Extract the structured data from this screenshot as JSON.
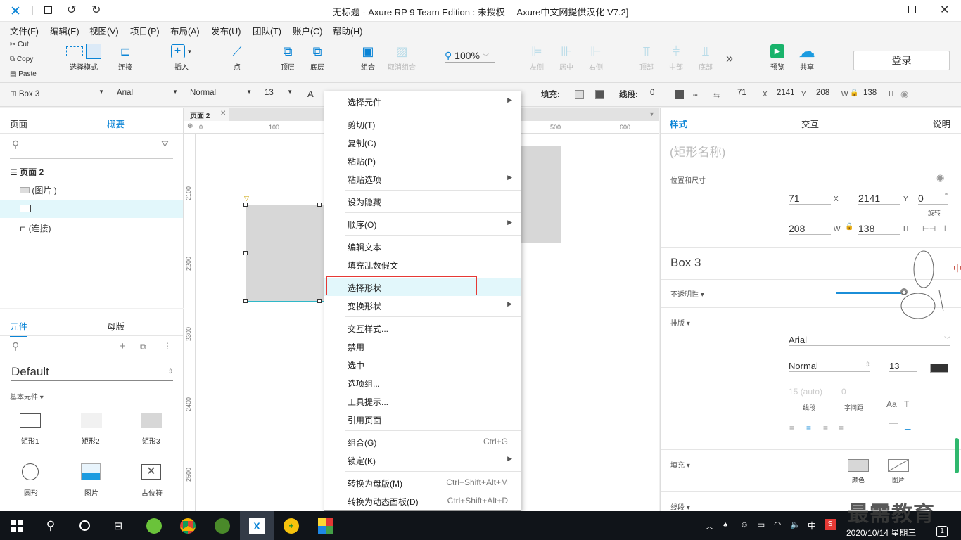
{
  "window": {
    "title": "无标题 - Axure RP 9 Team Edition : 未授权　 Axure中文网提供汉化 V7.2]"
  },
  "menu": [
    "文件(F)",
    "编辑(E)",
    "视图(V)",
    "项目(P)",
    "布局(A)",
    "发布(U)",
    "团队(T)",
    "账户(C)",
    "帮助(H)"
  ],
  "clipboard": {
    "cut": "Cut",
    "copy": "Copy",
    "paste": "Paste"
  },
  "toolbar": {
    "select_mode": "选择模式",
    "connect": "连接",
    "insert": "插入",
    "point": "点",
    "top": "顶层",
    "bottom": "底层",
    "group": "组合",
    "ungroup": "取消组合",
    "zoom": "100%",
    "align_left": "左侧",
    "align_center": "居中",
    "align_right": "右侧",
    "align_top": "顶部",
    "align_middle": "中部",
    "align_bottom": "底部",
    "preview": "预览",
    "share": "共享",
    "login": "登录"
  },
  "stylebar": {
    "widget": "Box 3",
    "font": "Arial",
    "weight": "Normal",
    "size": "13",
    "fill_label": "填充:",
    "stroke_label": "线段:",
    "stroke_value": "0",
    "x": "71",
    "x_label": "X",
    "y": "2141",
    "y_label": "Y",
    "w": "208",
    "w_label": "W",
    "h": "138",
    "h_label": "H"
  },
  "left_top": {
    "tab_pages": "页面",
    "tab_outline": "概要",
    "items": [
      {
        "label": "页面 2"
      },
      {
        "label": "(图片 )"
      },
      {
        "label": ""
      },
      {
        "label": "(连接)"
      }
    ]
  },
  "left_bottom": {
    "tab_widgets": "元件",
    "tab_masters": "母版",
    "library": "Default",
    "section": "基本元件 ▾",
    "widgets": [
      "矩形1",
      "矩形2",
      "矩形3",
      "圆形",
      "图片",
      "占位符"
    ]
  },
  "canvas": {
    "tab": "页面 2",
    "ruler_top": [
      "0",
      "100",
      "500",
      "600"
    ],
    "ruler_left": [
      "2100",
      "2200",
      "2300",
      "2400",
      "2500"
    ]
  },
  "context_menu": [
    {
      "label": "选择元件",
      "sub": true
    },
    {
      "label": "剪切(T)"
    },
    {
      "label": "复制(C)"
    },
    {
      "label": "粘贴(P)"
    },
    {
      "label": "粘贴选项",
      "sub": true
    },
    {
      "label": "设为隐藏"
    },
    {
      "label": "顺序(O)",
      "sub": true
    },
    {
      "label": "编辑文本"
    },
    {
      "label": "填充乱数假文"
    },
    {
      "label": "选择形状",
      "highlight": true
    },
    {
      "label": "变换形状",
      "sub": true
    },
    {
      "label": "交互样式..."
    },
    {
      "label": "禁用"
    },
    {
      "label": "选中"
    },
    {
      "label": "选项组..."
    },
    {
      "label": "工具提示..."
    },
    {
      "label": "引用页面"
    },
    {
      "label": "组合(G)",
      "shortcut": "Ctrl+G"
    },
    {
      "label": "锁定(K)",
      "sub": true
    },
    {
      "label": "转换为母版(M)",
      "shortcut": "Ctrl+Shift+Alt+M"
    },
    {
      "label": "转换为动态面板(D)",
      "shortcut": "Ctrl+Shift+Alt+D"
    }
  ],
  "right": {
    "tab_style": "样式",
    "tab_interact": "交互",
    "tab_notes": "说明",
    "name_placeholder": "(矩形名称)",
    "pos_size": "位置和尺寸",
    "x": "71",
    "x_label": "X",
    "y": "2141",
    "y_label": "Y",
    "rot": "0",
    "rot_unit": "°",
    "rot_label": "旋转",
    "w": "208",
    "w_label": "W",
    "h": "138",
    "h_label": "H",
    "widget_name": "Box 3",
    "opacity": "不透明性 ▾",
    "typography": "排版 ▾",
    "font": "Arial",
    "weight": "Normal",
    "size": "13",
    "line_height": "15 (auto)",
    "letter_spacing": "0",
    "line_height_label": "线段",
    "letter_spacing_label": "字间距",
    "fill": "填充 ▾",
    "fill_color": "颜色",
    "fill_image": "图片",
    "stroke": "线段 ▾"
  },
  "watermark": "最需教育",
  "taskbar": {
    "date": "2020/10/14 星期三",
    "ime": "中",
    "badge": "1"
  }
}
